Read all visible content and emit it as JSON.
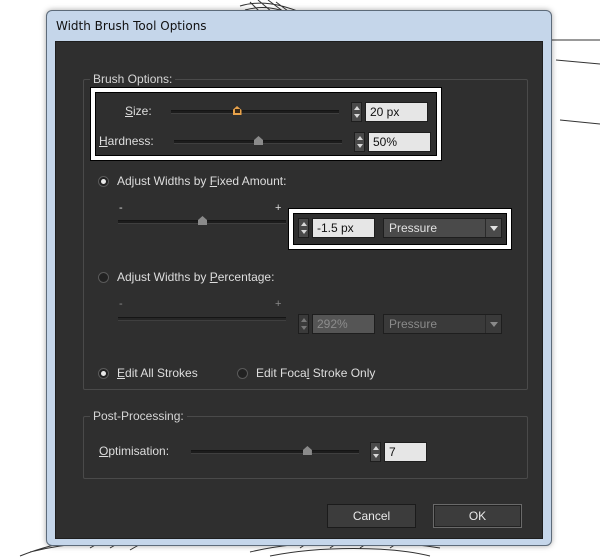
{
  "window": {
    "title": "Width Brush Tool Options"
  },
  "brush_options": {
    "group_label": "Brush Options:",
    "size": {
      "label_key": "S",
      "label_rest": "ize:",
      "value": "20 px",
      "slider_fraction": 0.39
    },
    "hardness": {
      "label_key": "H",
      "label_rest": "ardness:",
      "value": "50%",
      "slider_fraction": 0.5
    },
    "fixed": {
      "label_pre": "Adjust Widths by ",
      "label_key": "F",
      "label_post": "ixed Amount:",
      "selected": true,
      "minus": "-",
      "plus": "+",
      "value": "-1.5 px",
      "pressure": "Pressure",
      "slider_fraction": 0.5
    },
    "percentage": {
      "label_pre": "Adjust Widths by ",
      "label_key": "P",
      "label_post": "ercentage:",
      "selected": false,
      "minus": "-",
      "plus": "+",
      "value": "292%",
      "pressure": "Pressure"
    },
    "edit_all": {
      "label_key": "E",
      "label_rest": "dit All Strokes",
      "selected": true
    },
    "edit_focal": {
      "label_pre": "Edit Foca",
      "label_key": "l",
      "label_post": " Stroke Only",
      "selected": false
    }
  },
  "post_processing": {
    "group_label": "Post-Processing:",
    "optimisation": {
      "label_key": "O",
      "label_rest": "ptimisation:",
      "value": "7",
      "slider_fraction": 0.69
    }
  },
  "buttons": {
    "cancel": "Cancel",
    "ok": "OK"
  },
  "colors": {
    "accent_thumb": "#e8a24a",
    "dialog_bg": "#2f2f2f",
    "highlight": "#ffffff"
  }
}
